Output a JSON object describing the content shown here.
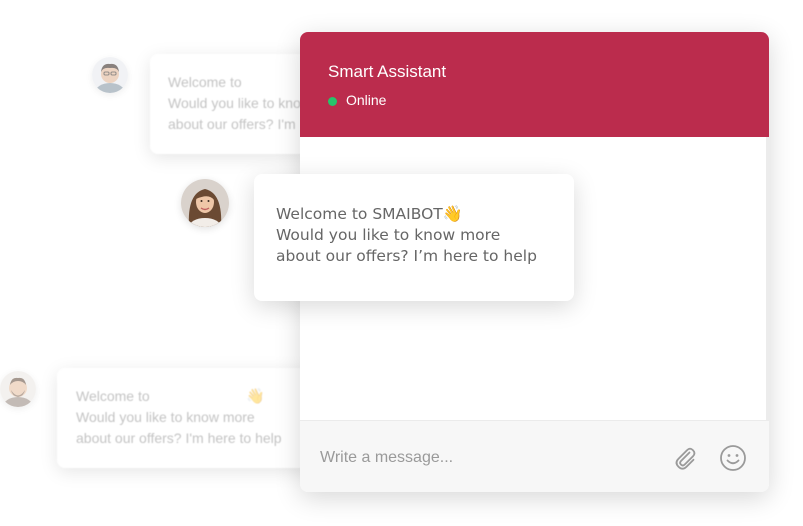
{
  "background_cards": {
    "top": {
      "lines": [
        "Welcome to",
        "Would you like to know",
        "about our offers? I'm"
      ]
    },
    "bottom": {
      "lines": [
        "Welcome to",
        "Would you like to know more",
        "about our offers? I'm here to help"
      ],
      "emoji": "👋"
    }
  },
  "chat": {
    "header": {
      "title": "Smart Assistant",
      "status": "Online"
    },
    "message": {
      "line1_prefix": "Welcome to SMAIBOT",
      "emoji": "👋",
      "line2": "Would you like to know more",
      "line3": "about our offers? I’m here to help"
    },
    "composer": {
      "placeholder": "Write a message..."
    }
  },
  "colors": {
    "header": "#bb2c4d",
    "status_dot": "#27c36b",
    "composer_bg": "#f7f7f7"
  },
  "icons": {
    "attach": "paperclip-icon",
    "emoji": "smiley-icon"
  }
}
